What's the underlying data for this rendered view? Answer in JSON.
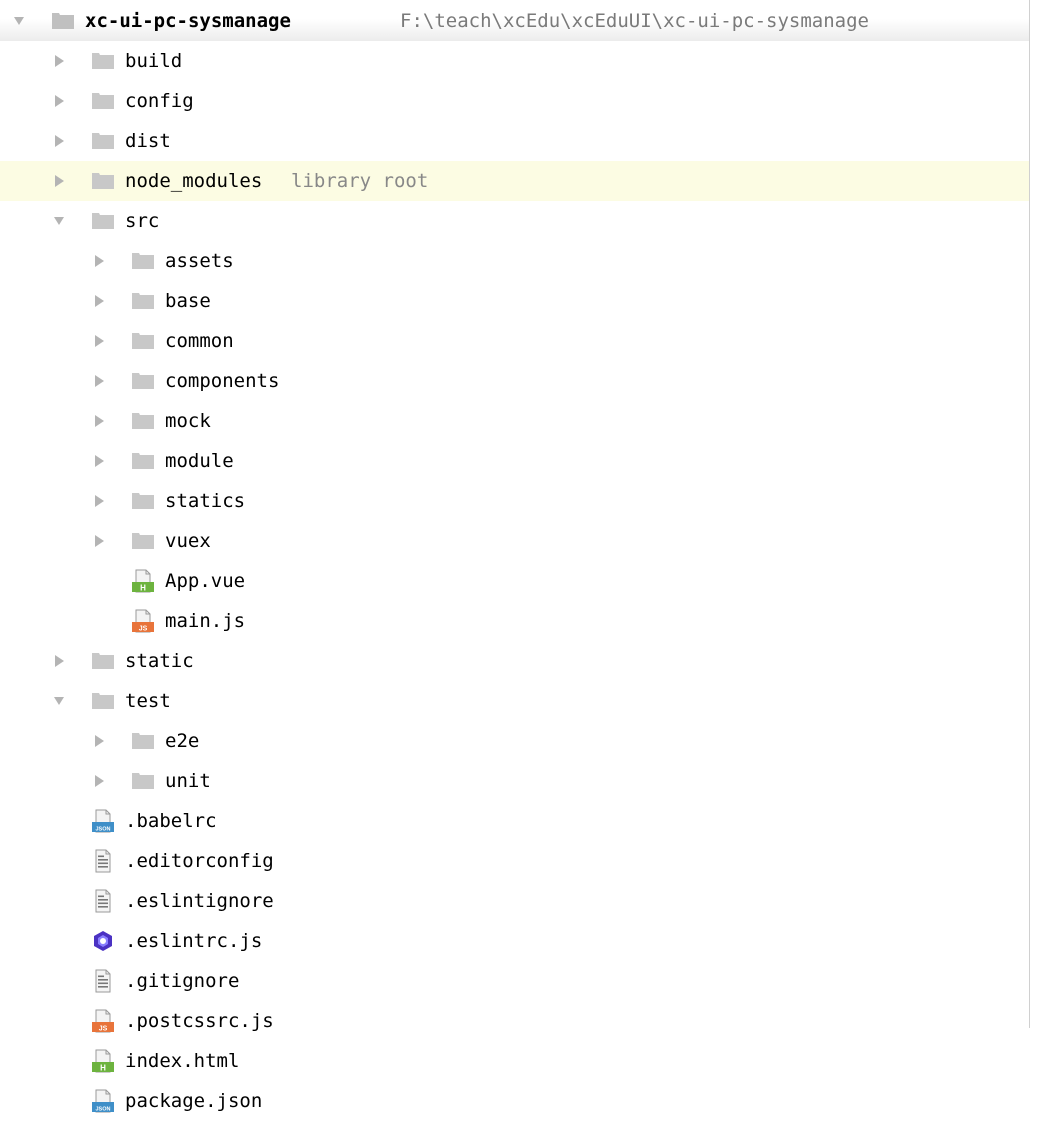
{
  "project": {
    "name": "xc-ui-pc-sysmanage",
    "path": "F:\\teach\\xcEdu\\xcEduUI\\xc-ui-pc-sysmanage"
  },
  "colors": {
    "folder": "#c8c8c8",
    "highlight_row": "#fcfce3",
    "arrow": "#b4b4b4",
    "hint_text": "#888888",
    "vue_badge": "#6db33f",
    "js_badge": "#e8743b",
    "json_badge": "#3f8fc8",
    "eslint_icon": "#4b32c3"
  },
  "tree": [
    {
      "label": "build",
      "kind": "folder",
      "arrow": "collapsed",
      "depth": 1
    },
    {
      "label": "config",
      "kind": "folder",
      "arrow": "collapsed",
      "depth": 1
    },
    {
      "label": "dist",
      "kind": "folder",
      "arrow": "collapsed",
      "depth": 1
    },
    {
      "label": "node_modules",
      "kind": "folder",
      "arrow": "collapsed",
      "depth": 1,
      "hint": "library root",
      "highlight": true
    },
    {
      "label": "src",
      "kind": "folder",
      "arrow": "expanded",
      "depth": 1
    },
    {
      "label": "assets",
      "kind": "folder",
      "arrow": "collapsed",
      "depth": 2
    },
    {
      "label": "base",
      "kind": "folder",
      "arrow": "collapsed",
      "depth": 2
    },
    {
      "label": "common",
      "kind": "folder",
      "arrow": "collapsed",
      "depth": 2
    },
    {
      "label": "components",
      "kind": "folder",
      "arrow": "collapsed",
      "depth": 2
    },
    {
      "label": "mock",
      "kind": "folder",
      "arrow": "collapsed",
      "depth": 2
    },
    {
      "label": "module",
      "kind": "folder",
      "arrow": "collapsed",
      "depth": 2
    },
    {
      "label": "statics",
      "kind": "folder",
      "arrow": "collapsed",
      "depth": 2
    },
    {
      "label": "vuex",
      "kind": "folder",
      "arrow": "collapsed",
      "depth": 2
    },
    {
      "label": "App.vue",
      "kind": "vue-file",
      "arrow": "none",
      "depth": 2,
      "badge": "H"
    },
    {
      "label": "main.js",
      "kind": "js-file",
      "arrow": "none",
      "depth": 2,
      "badge": "JS"
    },
    {
      "label": "static",
      "kind": "folder",
      "arrow": "collapsed",
      "depth": 1
    },
    {
      "label": "test",
      "kind": "folder",
      "arrow": "expanded",
      "depth": 1
    },
    {
      "label": "e2e",
      "kind": "folder",
      "arrow": "collapsed",
      "depth": 2
    },
    {
      "label": "unit",
      "kind": "folder",
      "arrow": "collapsed",
      "depth": 2
    },
    {
      "label": ".babelrc",
      "kind": "json-file",
      "arrow": "none",
      "depth": 1,
      "badge": "JSON"
    },
    {
      "label": ".editorconfig",
      "kind": "text-file",
      "arrow": "none",
      "depth": 1
    },
    {
      "label": ".eslintignore",
      "kind": "text-file",
      "arrow": "none",
      "depth": 1
    },
    {
      "label": ".eslintrc.js",
      "kind": "eslint-file",
      "arrow": "none",
      "depth": 1
    },
    {
      "label": ".gitignore",
      "kind": "text-file",
      "arrow": "none",
      "depth": 1
    },
    {
      "label": ".postcssrc.js",
      "kind": "js-file",
      "arrow": "none",
      "depth": 1,
      "badge": "JS"
    },
    {
      "label": "index.html",
      "kind": "vue-file",
      "arrow": "none",
      "depth": 1,
      "badge": "H"
    },
    {
      "label": "package.json",
      "kind": "json-file",
      "arrow": "none",
      "depth": 1,
      "badge": "JSON"
    }
  ]
}
